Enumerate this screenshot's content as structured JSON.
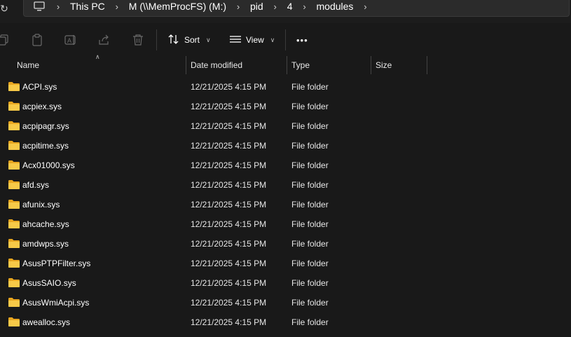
{
  "addressbar": {
    "crumbs": [
      "This PC",
      "M (\\\\MemProcFS) (M:)",
      "pid",
      "4",
      "modules"
    ]
  },
  "toolbar": {
    "sort_label": "Sort",
    "view_label": "View",
    "more_label": "•••"
  },
  "columns": {
    "name": "Name",
    "date": "Date modified",
    "type": "Type",
    "size": "Size"
  },
  "files": [
    {
      "name": "ACPI.sys",
      "date": "12/21/2025 4:15 PM",
      "type": "File folder"
    },
    {
      "name": "acpiex.sys",
      "date": "12/21/2025 4:15 PM",
      "type": "File folder"
    },
    {
      "name": "acpipagr.sys",
      "date": "12/21/2025 4:15 PM",
      "type": "File folder"
    },
    {
      "name": "acpitime.sys",
      "date": "12/21/2025 4:15 PM",
      "type": "File folder"
    },
    {
      "name": "Acx01000.sys",
      "date": "12/21/2025 4:15 PM",
      "type": "File folder"
    },
    {
      "name": "afd.sys",
      "date": "12/21/2025 4:15 PM",
      "type": "File folder"
    },
    {
      "name": "afunix.sys",
      "date": "12/21/2025 4:15 PM",
      "type": "File folder"
    },
    {
      "name": "ahcache.sys",
      "date": "12/21/2025 4:15 PM",
      "type": "File folder"
    },
    {
      "name": "amdwps.sys",
      "date": "12/21/2025 4:15 PM",
      "type": "File folder"
    },
    {
      "name": "AsusPTPFilter.sys",
      "date": "12/21/2025 4:15 PM",
      "type": "File folder"
    },
    {
      "name": "AsusSAIO.sys",
      "date": "12/21/2025 4:15 PM",
      "type": "File folder"
    },
    {
      "name": "AsusWmiAcpi.sys",
      "date": "12/21/2025 4:15 PM",
      "type": "File folder"
    },
    {
      "name": "awealloc.sys",
      "date": "12/21/2025 4:15 PM",
      "type": "File folder"
    }
  ]
}
